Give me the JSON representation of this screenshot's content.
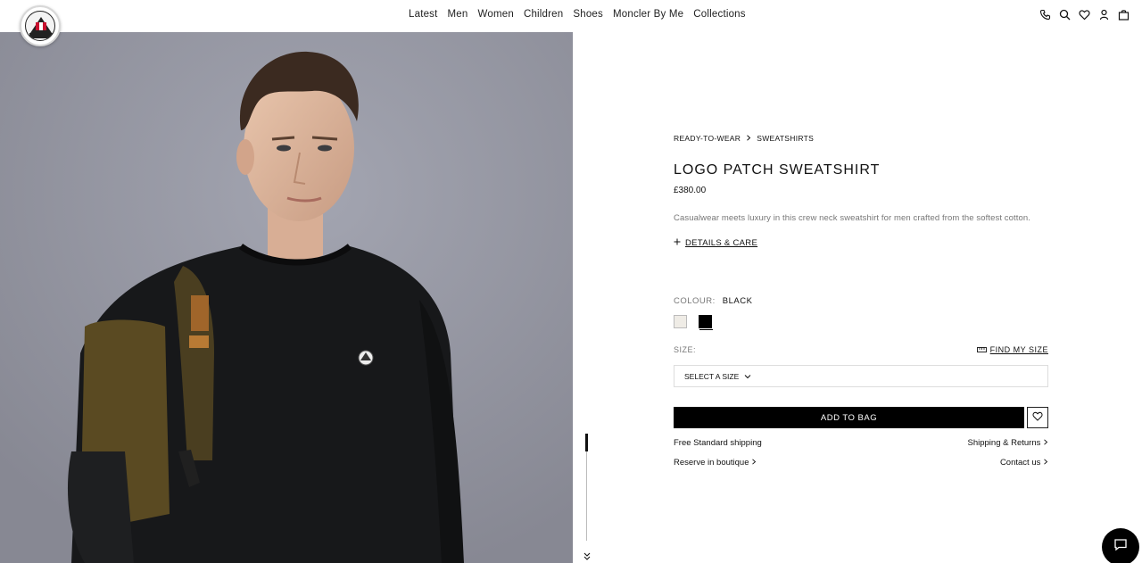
{
  "header": {
    "logo_text": "MONCLER",
    "nav": [
      "Latest",
      "Men",
      "Women",
      "Children",
      "Shoes",
      "Moncler By Me",
      "Collections"
    ],
    "icons": [
      "phone-icon",
      "search-icon",
      "heart-icon",
      "account-icon",
      "bag-icon"
    ]
  },
  "breadcrumb": [
    "READY-TO-WEAR",
    "SWEATSHIRTS"
  ],
  "product": {
    "title": "LOGO PATCH SWEATSHIRT",
    "price": "£380.00",
    "description": "Casualwear meets luxury in this crew neck sweatshirt for men crafted from the softest cotton.",
    "details_label": "DETAILS & CARE"
  },
  "colour": {
    "label": "COLOUR:",
    "value": "BLACK",
    "swatches": [
      "ivory",
      "black"
    ],
    "selected": "black"
  },
  "size": {
    "label": "SIZE:",
    "find_my_size": "FIND MY SIZE",
    "select_placeholder": "SELECT A SIZE"
  },
  "actions": {
    "add_to_bag": "ADD TO BAG"
  },
  "links": {
    "free_shipping": "Free Standard shipping",
    "shipping_returns": "Shipping & Returns",
    "reserve": "Reserve in boutique",
    "contact": "Contact us"
  }
}
